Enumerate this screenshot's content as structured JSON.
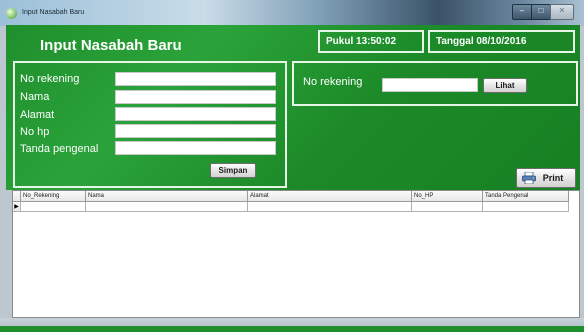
{
  "window": {
    "title": "Input Nasabah Baru",
    "controls": {
      "minimize_icon": "minimize-icon",
      "maximize_icon": "maximize-icon",
      "close_icon": "close-icon",
      "minimize": "–",
      "maximize": "□",
      "close": "✕"
    }
  },
  "header": {
    "form_title": "Input Nasabah Baru",
    "pukul": "Pukul  13:50:02",
    "tanggal": "Tanggal  08/10/2016"
  },
  "form": {
    "fields": [
      {
        "label": "No rekening",
        "value": ""
      },
      {
        "label": "Nama",
        "value": ""
      },
      {
        "label": "Alamat",
        "value": ""
      },
      {
        "label": "No hp",
        "value": ""
      },
      {
        "label": "Tanda pengenal",
        "value": ""
      }
    ],
    "simpan_label": "Simpan"
  },
  "search": {
    "label": "No rekening",
    "value": "",
    "lihat_label": "Lihat"
  },
  "print": {
    "label": "Print",
    "icon": "printer-icon"
  },
  "grid": {
    "columns": [
      "No_Rekening",
      "Nama",
      "Alamat",
      "No_HP",
      "Tanda Pengenal"
    ],
    "row_marker": "▶"
  },
  "colors": {
    "panel_green": "#1f8f2c",
    "border": "#e6f5e6",
    "titlebar": "#3a5268"
  }
}
